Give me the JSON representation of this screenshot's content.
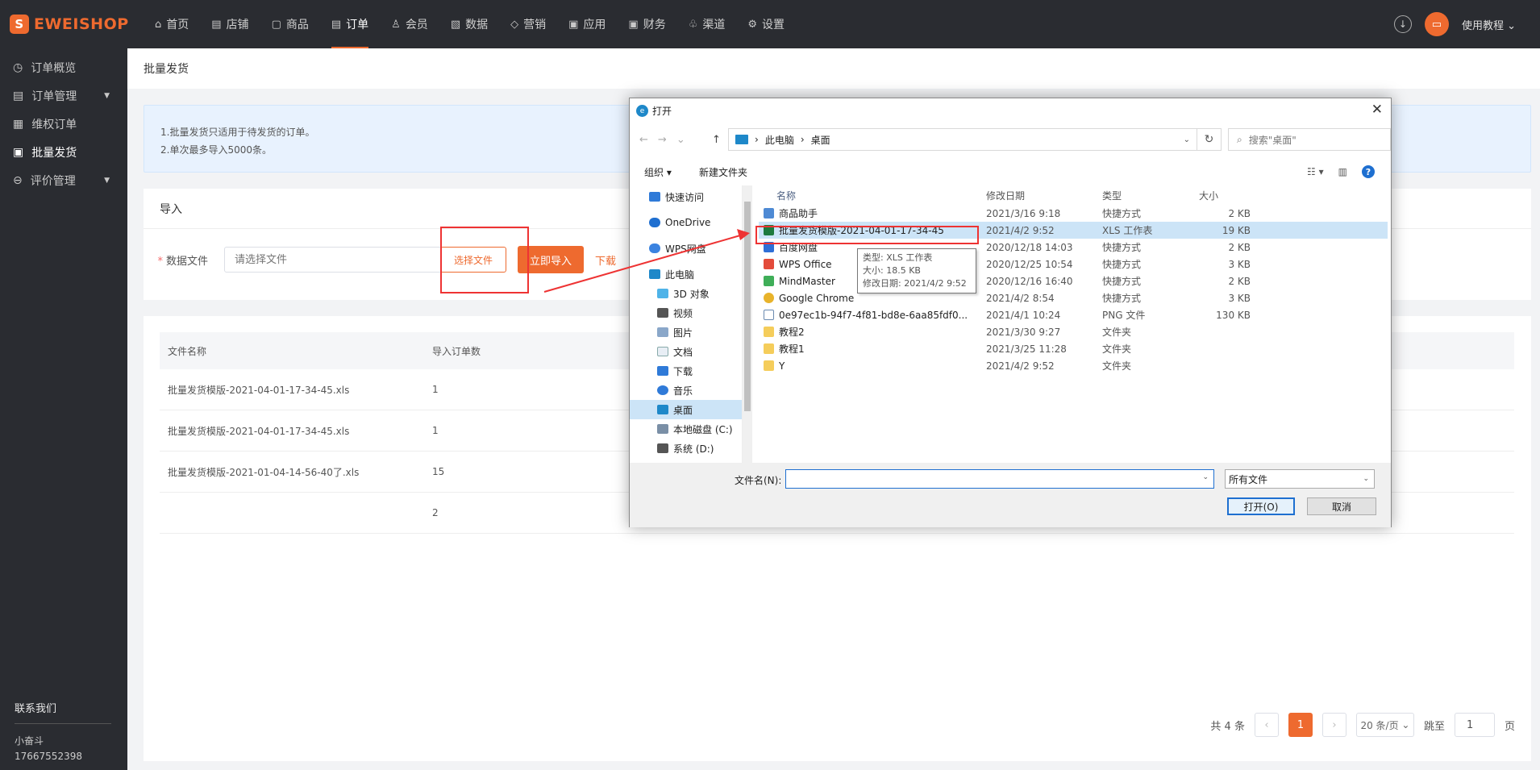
{
  "brand": {
    "name": "EWEISHOP",
    "mark": "S"
  },
  "nav": [
    {
      "label": "首页",
      "icon": "⌂"
    },
    {
      "label": "店铺",
      "icon": "▤"
    },
    {
      "label": "商品",
      "icon": "▢"
    },
    {
      "label": "订单",
      "icon": "▤"
    },
    {
      "label": "会员",
      "icon": "♙"
    },
    {
      "label": "数据",
      "icon": "▧"
    },
    {
      "label": "营销",
      "icon": "◇"
    },
    {
      "label": "应用",
      "icon": "▣"
    },
    {
      "label": "财务",
      "icon": "▣"
    },
    {
      "label": "渠道",
      "icon": "♧"
    },
    {
      "label": "设置",
      "icon": "⚙"
    }
  ],
  "header": {
    "user_label": "使用教程",
    "avatar_glyph": "▭"
  },
  "sidebar": {
    "items": [
      {
        "label": "订单概览",
        "icon": "◷"
      },
      {
        "label": "订单管理",
        "icon": "▤"
      },
      {
        "label": "维权订单",
        "icon": "▦"
      },
      {
        "label": "批量发货",
        "icon": "▣"
      },
      {
        "label": "评价管理",
        "icon": "⊖"
      }
    ],
    "contact_title": "联系我们",
    "contact_name": "小奋斗",
    "contact_phone": "17667552398"
  },
  "page": {
    "breadcrumb": "批量发货",
    "notice_line1": "1.批量发货只适用于待发货的订单。",
    "notice_line2": "2.单次最多导入5000条。",
    "import_title": "导入",
    "required_mark": "*",
    "file_label": "数据文件",
    "file_placeholder": "请选择文件",
    "choose_button": "选择文件",
    "import_button": "立即导入",
    "download_link": "下载"
  },
  "table": {
    "headers": [
      "文件名称",
      "导入订单数"
    ],
    "rows": [
      [
        "批量发货模版-2021-04-01-17-34-45.xls",
        "1"
      ],
      [
        "批量发货模版-2021-04-01-17-34-45.xls",
        "1"
      ],
      [
        "批量发货模版-2021-01-04-14-56-40了.xls",
        "15"
      ],
      [
        "",
        "2"
      ]
    ]
  },
  "pager": {
    "total": "共 4 条",
    "current": "1",
    "page_size": "20 条/页",
    "jump_label": "跳至",
    "jump_value": "1",
    "page_unit": "页"
  },
  "dialog": {
    "title": "打开",
    "path": [
      "此电脑",
      "桌面"
    ],
    "search_placeholder": "搜索\"桌面\"",
    "organize": "组织 ▾",
    "new_folder": "新建文件夹",
    "help": "?",
    "left_items": [
      {
        "label": "快速访问",
        "indent": 1
      },
      {
        "label": "OneDrive",
        "indent": 1
      },
      {
        "label": "WPS网盘",
        "indent": 1
      },
      {
        "label": "此电脑",
        "indent": 1
      },
      {
        "label": "3D 对象",
        "indent": 2
      },
      {
        "label": "视频",
        "indent": 2
      },
      {
        "label": "图片",
        "indent": 2
      },
      {
        "label": "文档",
        "indent": 2
      },
      {
        "label": "下载",
        "indent": 2
      },
      {
        "label": "音乐",
        "indent": 2
      },
      {
        "label": "桌面",
        "indent": 2
      },
      {
        "label": "本地磁盘 (C:)",
        "indent": 2
      },
      {
        "label": "系统 (D:)",
        "indent": 2
      }
    ],
    "columns": [
      "名称",
      "修改日期",
      "类型",
      "大小"
    ],
    "files": [
      {
        "name": "商品助手",
        "date": "2021/3/16 9:18",
        "type": "快捷方式",
        "size": "2 KB",
        "icon": "short"
      },
      {
        "name": "批量发货模版-2021-04-01-17-34-45",
        "date": "2021/4/2 9:52",
        "type": "XLS 工作表",
        "size": "19 KB",
        "icon": "xls"
      },
      {
        "name": "百度网盘",
        "date": "2020/12/18 14:03",
        "type": "快捷方式",
        "size": "2 KB",
        "icon": "bd"
      },
      {
        "name": "WPS Office",
        "date": "2020/12/25 10:54",
        "type": "快捷方式",
        "size": "3 KB",
        "icon": "wps"
      },
      {
        "name": "MindMaster",
        "date": "2020/12/16 16:40",
        "type": "快捷方式",
        "size": "2 KB",
        "icon": "mm"
      },
      {
        "name": "Google Chrome",
        "date": "2021/4/2 8:54",
        "type": "快捷方式",
        "size": "3 KB",
        "icon": "chrome"
      },
      {
        "name": "0e97ec1b-94f7-4f81-bd8e-6aa85fdf0...",
        "date": "2021/4/1 10:24",
        "type": "PNG 文件",
        "size": "130 KB",
        "icon": "png"
      },
      {
        "name": "教程2",
        "date": "2021/3/30 9:27",
        "type": "文件夹",
        "size": "",
        "icon": "folder"
      },
      {
        "name": "教程1",
        "date": "2021/3/25 11:28",
        "type": "文件夹",
        "size": "",
        "icon": "folder"
      },
      {
        "name": "Y",
        "date": "2021/4/2 9:52",
        "type": "文件夹",
        "size": "",
        "icon": "folder"
      }
    ],
    "tooltip_lines": [
      "类型: XLS 工作表",
      "大小: 18.5 KB",
      "修改日期: 2021/4/2 9:52"
    ],
    "filename_label": "文件名(N):",
    "filename_value": "",
    "filetype": "所有文件",
    "open_button": "打开(O)",
    "cancel_button": "取消"
  },
  "colors": {
    "accent": "#ee6a2f",
    "topbar": "#2a2c31",
    "highlight": "#e33333"
  }
}
